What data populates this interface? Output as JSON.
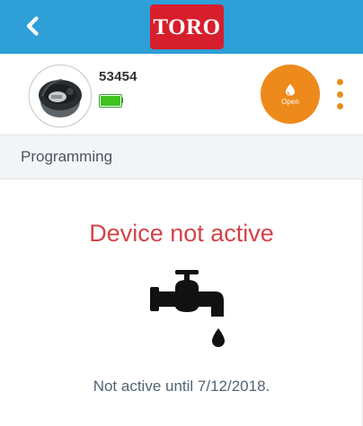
{
  "header": {
    "back_icon": "chevron-left-icon",
    "brand": "TORO",
    "brand_color": "#d71e2c",
    "bar_color": "#2f9fd8"
  },
  "device": {
    "id": "53454",
    "battery_level": 1.0,
    "battery_icon": "battery-full-icon",
    "open_button_label": "Open",
    "open_button_icon": "water-drop-icon",
    "accent_color": "#ee8a1b",
    "menu_icon": "more-vertical-icon"
  },
  "section": {
    "title": "Programming"
  },
  "status": {
    "title": "Device not active",
    "title_color": "#d3444a",
    "icon": "water-tap-icon",
    "note": "Not active until 7/12/2018."
  }
}
